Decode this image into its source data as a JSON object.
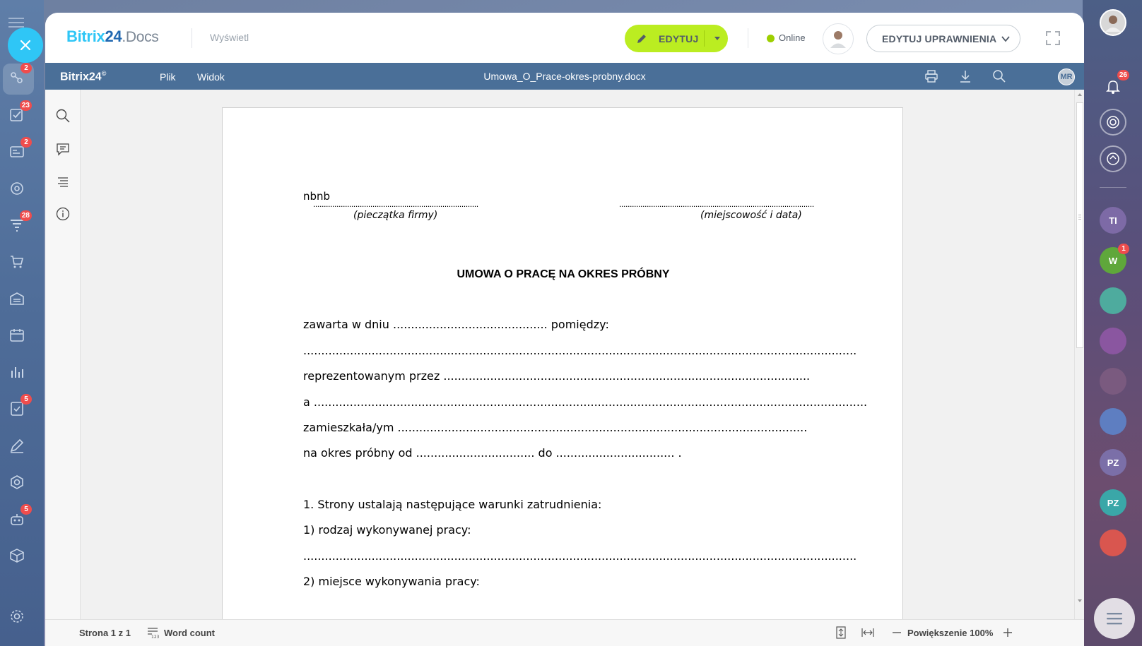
{
  "left_sidebar": {
    "items": [
      {
        "icon": "crm-icon",
        "badge": "2"
      },
      {
        "icon": "tasks-icon",
        "badge": "23"
      },
      {
        "icon": "feed-icon",
        "badge": "2"
      },
      {
        "icon": "sites-icon",
        "badge": ""
      },
      {
        "icon": "funnel-icon",
        "badge": "28"
      },
      {
        "icon": "shop-icon",
        "badge": ""
      },
      {
        "icon": "store-icon",
        "badge": ""
      },
      {
        "icon": "calendar-icon",
        "badge": ""
      },
      {
        "icon": "analytics-icon",
        "badge": ""
      },
      {
        "icon": "checklist-icon",
        "badge": "5"
      },
      {
        "icon": "sign-icon",
        "badge": ""
      },
      {
        "icon": "hexagon-icon",
        "badge": ""
      },
      {
        "icon": "robot-icon",
        "badge": "5"
      },
      {
        "icon": "box-icon",
        "badge": ""
      },
      {
        "icon": "settings-icon",
        "badge": ""
      }
    ]
  },
  "right_sidebar": {
    "notifications_badge": "26",
    "items": [
      {
        "label": "TI",
        "color": "#7d6aa6",
        "badge": ""
      },
      {
        "label": "W",
        "color": "#5fa73b",
        "badge": "1"
      },
      {
        "label": "",
        "color": "#4eab9e",
        "badge": ""
      },
      {
        "label": "",
        "color": "#8a56a0",
        "badge": ""
      },
      {
        "label": "",
        "color": "#7a5a7f",
        "badge": ""
      },
      {
        "label": "",
        "color": "#5e7ec1",
        "badge": ""
      },
      {
        "label": "PZ",
        "color": "#7b6fa8",
        "badge": ""
      },
      {
        "label": "PZ",
        "color": "#3aa7a8",
        "badge": ""
      },
      {
        "label": "",
        "color": "#d9564f",
        "badge": ""
      }
    ]
  },
  "topbar": {
    "brand_part1": "Bitrix",
    "brand_part2": "24",
    "brand_part3": ".Docs",
    "view_label": "Wyświetl",
    "edit_label": "EDYTUJ",
    "online_label": "Online",
    "permissions_label": "EDYTUJ UPRAWNIENIA"
  },
  "editor_bar": {
    "brand": "Bitrix24",
    "menu": [
      "Plik",
      "Widok"
    ],
    "file_name": "Umowa_O_Prace-okres-probny.docx",
    "user_initials": "MR"
  },
  "document": {
    "company_name": "nbnb",
    "dots_left": "..............................................................................",
    "dots_right": "............................................................................................",
    "stamp_caption": "(pieczątka firmy)",
    "place_caption": "(miejscowość i data)",
    "title": "UMOWA O PRACĘ NA OKRES PRÓBNY",
    "lines": [
      "zawarta w dniu ........................................... pomiędzy:",
      "..........................................................................................................................................................",
      "reprezentowanym przez    ......................................................................................................",
      "a ..........................................................................................................................................................",
      "zamieszkała/ym ..................................................................................................................",
      "na okres próbny od ................................. do ................................. .",
      "",
      "1. Strony ustalają następujące warunki zatrudnienia:",
      "1) rodzaj wykonywanej pracy:",
      "..........................................................................................................................................................",
      "2) miejsce wykonywania pracy:"
    ]
  },
  "statusbar": {
    "page_info": "Strona 1 z 1",
    "word_count": "Word count",
    "zoom": "Powiększenie 100%"
  },
  "colors": {
    "accent_green": "#bbed21",
    "editor_blue": "#4a6f98",
    "brand_cyan": "#2fc6f6"
  }
}
